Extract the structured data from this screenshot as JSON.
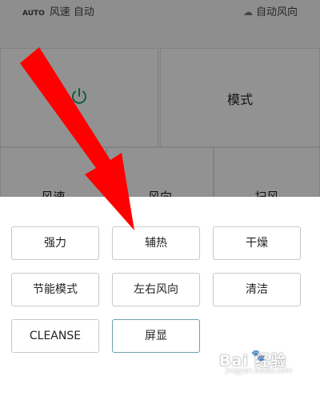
{
  "status": {
    "auto_label": "AUTO",
    "wind_speed_label": "风速 自动",
    "cloud_icon": "cloud-icon",
    "wind_direction_label": "自动风向"
  },
  "top_tiles": {
    "power_icon": "power-icon",
    "power_color": "#1aa36b",
    "mode_label": "模式"
  },
  "bottom_tiles": [
    {
      "label": "风速"
    },
    {
      "label": "风向"
    },
    {
      "label": "扫风"
    }
  ],
  "options": [
    {
      "label": "强力"
    },
    {
      "label": "辅热"
    },
    {
      "label": "干燥"
    },
    {
      "label": "节能模式"
    },
    {
      "label": "左右风向"
    },
    {
      "label": "清洁"
    },
    {
      "label": "CLEANSE"
    },
    {
      "label": "屏显",
      "selected": true
    }
  ],
  "annotation": {
    "arrow_color": "#ff0000"
  },
  "watermark": {
    "logo_text": "Bai 经验",
    "url": "jingyan.baidu.com"
  },
  "colors": {
    "selected_border": "#6fa0b3",
    "dim_overlay": "rgba(0,0,0,0.42)"
  }
}
